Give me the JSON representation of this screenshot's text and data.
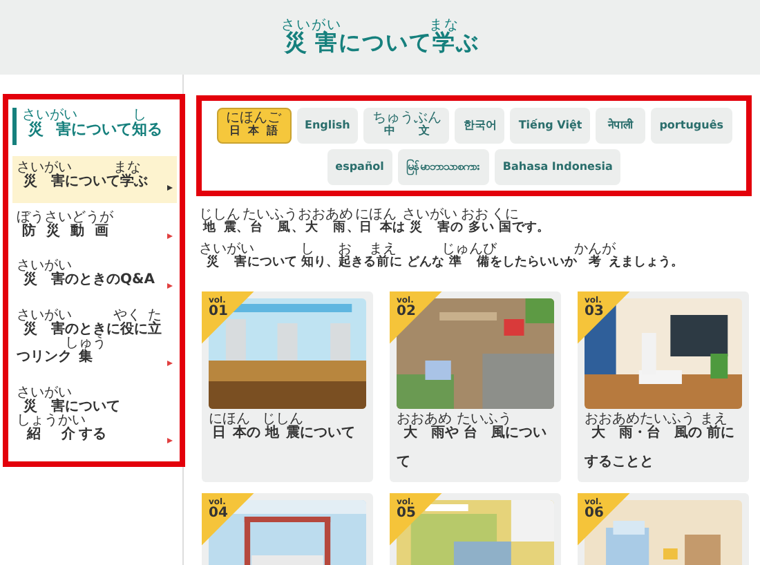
{
  "header": {
    "title": [
      [
        "さいがい",
        "災害"
      ],
      [
        "について"
      ],
      [
        "まな",
        "学"
      ],
      [
        "ぶ"
      ]
    ]
  },
  "sidebar": {
    "heading": [
      [
        "さいがい",
        "災害"
      ],
      [
        "について"
      ],
      [
        "し",
        "知"
      ],
      [
        "る"
      ]
    ],
    "items": [
      {
        "label": [
          [
            "さいがい",
            "災害"
          ],
          [
            "について"
          ],
          [
            "まな",
            "学"
          ],
          [
            "ぶ"
          ]
        ],
        "selected": true
      },
      {
        "label": [
          [
            "ぼうさいどうが",
            "防災動画"
          ]
        ],
        "selected": false
      },
      {
        "label": [
          [
            "さいがい",
            "災害"
          ],
          [
            "のときのQ&A"
          ]
        ],
        "selected": false
      },
      {
        "label": [
          [
            "さいがい",
            "災害"
          ],
          [
            "のときに"
          ],
          [
            "やく",
            "役"
          ],
          [
            "に"
          ],
          [
            "た",
            "立"
          ],
          [
            "つリンク"
          ],
          [
            "しゅう",
            "集"
          ]
        ],
        "selected": false
      },
      {
        "label": [
          [
            "さいがい",
            "災害"
          ],
          [
            "について"
          ],
          [
            "しょうかい",
            "紹介"
          ],
          [
            "する"
          ]
        ],
        "selected": false
      }
    ]
  },
  "languages": [
    {
      "label": [
        [
          "にほんご",
          "日本語"
        ]
      ],
      "selected": true
    },
    {
      "label": [
        [
          "English"
        ]
      ],
      "selected": false
    },
    {
      "label": [
        [
          "ちゅうぶん",
          "中文"
        ]
      ],
      "selected": false
    },
    {
      "label": [
        [
          "한국어"
        ]
      ],
      "selected": false
    },
    {
      "label": [
        [
          "Tiếng Việt"
        ]
      ],
      "selected": false
    },
    {
      "label": [
        [
          "नेपाली"
        ]
      ],
      "selected": false
    },
    {
      "label": [
        [
          "português"
        ]
      ],
      "selected": false
    },
    {
      "label": [
        [
          "español"
        ]
      ],
      "selected": false
    },
    {
      "label": [
        [
          "မြန်မာဘာသာစကား"
        ]
      ],
      "selected": false
    },
    {
      "label": [
        [
          "Bahasa Indonesia"
        ]
      ],
      "selected": false
    }
  ],
  "intro": [
    [
      [
        "じしん",
        "地震"
      ],
      [
        "、"
      ],
      [
        "たいふう",
        "台風"
      ],
      [
        "、"
      ],
      [
        "おおあめ",
        "大雨"
      ],
      [
        "、"
      ],
      [
        "にほん",
        "日本"
      ],
      [
        "は "
      ],
      [
        "さいがい",
        "災害"
      ],
      [
        "の "
      ],
      [
        "おお",
        "多"
      ],
      [
        "い "
      ],
      [
        "くに",
        "国"
      ],
      [
        "です。"
      ]
    ],
    [
      [
        "さいがい",
        "災害"
      ],
      [
        "について "
      ],
      [
        "し",
        "知"
      ],
      [
        "り、"
      ],
      [
        "お",
        "起"
      ],
      [
        "きる"
      ],
      [
        "まえ",
        "前"
      ],
      [
        "に どんな "
      ],
      [
        "じゅんび",
        "準備"
      ],
      [
        "をしたらいいか "
      ],
      [
        "かんが",
        "考"
      ],
      [
        "えましょう。"
      ]
    ]
  ],
  "articles": [
    {
      "vol": "vol.",
      "number": "01",
      "title": [
        [
          "にほん",
          "日本"
        ],
        [
          "の "
        ],
        [
          "じしん",
          "地震"
        ],
        [
          "について"
        ]
      ]
    },
    {
      "vol": "vol.",
      "number": "02",
      "title": [
        [
          "おおあめ",
          "大雨"
        ],
        [
          "や "
        ],
        [
          "たいふう",
          "台風"
        ],
        [
          "について"
        ]
      ]
    },
    {
      "vol": "vol.",
      "number": "03",
      "title": [
        [
          "おおあめ",
          "大雨"
        ],
        [
          "・"
        ],
        [
          "たいふう",
          "台風"
        ],
        [
          "の "
        ],
        [
          "まえ",
          "前"
        ],
        [
          "にすることと"
        ]
      ]
    },
    {
      "vol": "vol.",
      "number": "04"
    },
    {
      "vol": "vol.",
      "number": "05"
    },
    {
      "vol": "vol.",
      "number": "06"
    }
  ]
}
